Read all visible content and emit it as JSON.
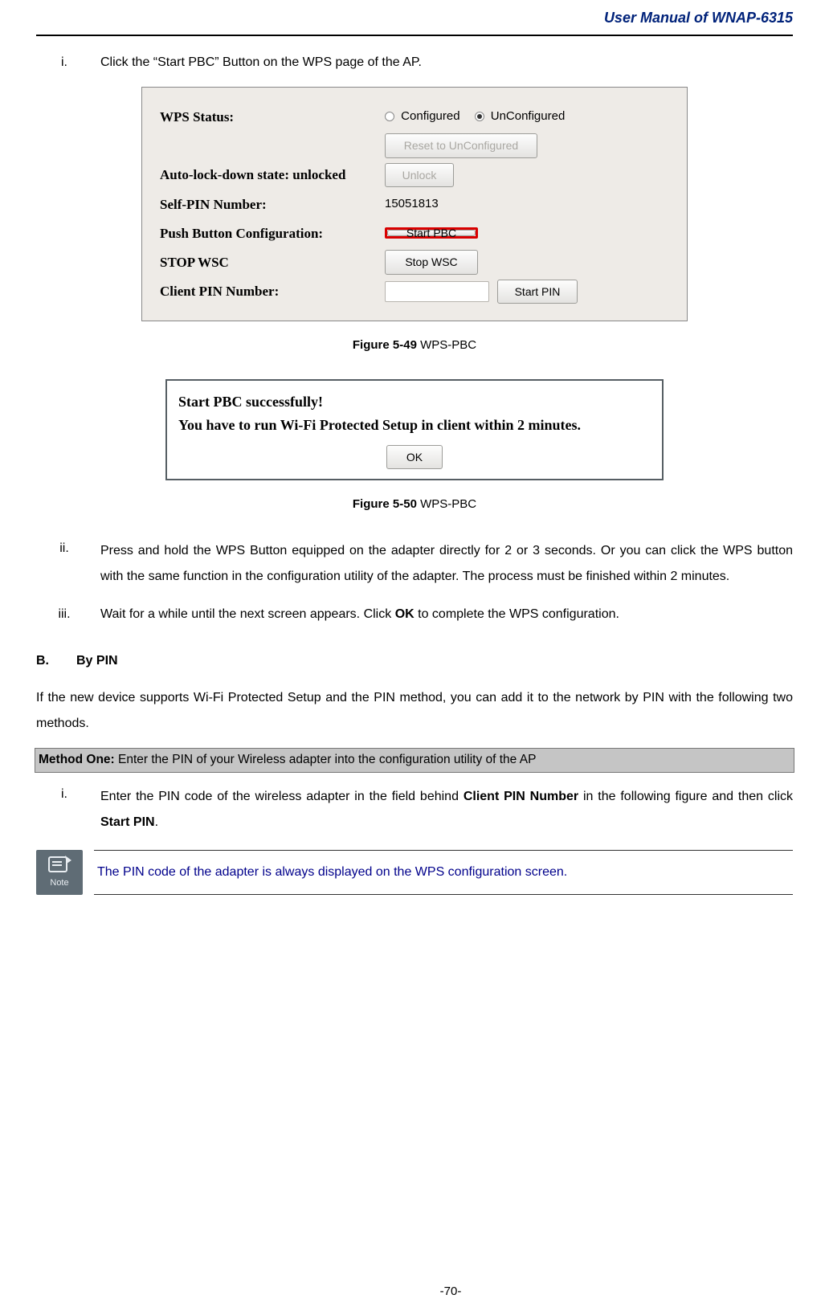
{
  "header": {
    "title": "User Manual of WNAP-6315"
  },
  "steps_top": [
    {
      "num": "i.",
      "text": "Click the “Start PBC” Button on the WPS page of the AP."
    }
  ],
  "fig49": {
    "rows": {
      "wps_status_label": "WPS Status:",
      "configured": "Configured",
      "unconfigured": "UnConfigured",
      "reset_btn": "Reset to UnConfigured",
      "autolock_label": "Auto-lock-down state: unlocked",
      "unlock_btn": "Unlock",
      "selfpin_label": "Self-PIN Number:",
      "selfpin_value": "15051813",
      "pbc_label": "Push Button Configuration:",
      "start_pbc_btn": "Start PBC",
      "stop_label": "STOP WSC",
      "stop_btn": "Stop WSC",
      "clientpin_label": "Client PIN Number:",
      "start_pin_btn": "Start PIN"
    }
  },
  "caption49": {
    "bold": "Figure 5-49",
    "rest": " WPS-PBC"
  },
  "fig50": {
    "line1": "Start PBC successfully!",
    "line2": "You have to run Wi-Fi Protected Setup in client within 2 minutes.",
    "ok": "OK"
  },
  "caption50": {
    "bold": "Figure 5-50",
    "rest": " WPS-PBC"
  },
  "steps_mid": [
    {
      "num": "ii.",
      "text": "Press and hold the WPS Button equipped on the adapter directly for 2 or 3 seconds. Or you can click the WPS button with the same function in the configuration utility of the adapter. The process must be finished within 2 minutes."
    },
    {
      "num": "iii.",
      "text_pre": "Wait for a while until the next screen appears. Click ",
      "text_bold": "OK",
      "text_post": " to complete the WPS configuration."
    }
  ],
  "sectionB": {
    "lbl": "B.",
    "title": "By PIN",
    "intro": "If the new device supports Wi-Fi Protected Setup and the PIN method, you can add it to the network by PIN with the following two methods.",
    "method_bold": "Method One:",
    "method_rest": " Enter the PIN of your Wireless adapter into the configuration utility of the AP",
    "step": {
      "num": "i.",
      "t1": "Enter the PIN code of the wireless adapter in the field behind ",
      "b1": "Client PIN Number",
      "t2": " in the following figure and then click ",
      "b2": "Start PIN",
      "t3": "."
    }
  },
  "note": {
    "label": "Note",
    "text": "The PIN code of the adapter is always displayed on the WPS configuration screen."
  },
  "page_number": "-70-"
}
